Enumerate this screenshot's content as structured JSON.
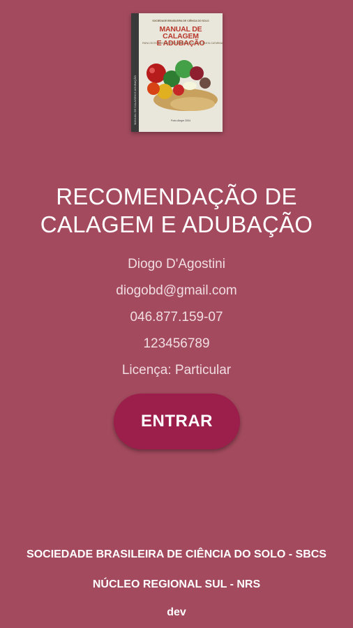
{
  "book_cover": {
    "publisher": "SOCIEDADE BRASILEIRA DE CIÊNCIA DO SOLO",
    "title_line1": "MANUAL DE CALAGEM",
    "title_line2": "E ADUBAÇÃO",
    "subtitle": "PARA OS ESTADOS DO RIO GRANDE DO SUL E DE SANTA CATARINA",
    "spine": "MANUAL DE CALAGEM E ADUBAÇÃO",
    "footer": "Porto Alegre 2004"
  },
  "headline": {
    "line1": "RECOMENDAÇÃO DE",
    "line2": "CALAGEM E ADUBAÇÃO"
  },
  "user": {
    "name": "Diogo D'Agostini",
    "email": "diogobd@gmail.com",
    "cpf": "046.877.159-07",
    "code": "123456789",
    "license": "Licença: Particular"
  },
  "actions": {
    "enter_label": "ENTRAR"
  },
  "footer": {
    "society": "SOCIEDADE BRASILEIRA DE CIÊNCIA DO SOLO - SBCS",
    "nucleus": "NÚCLEO REGIONAL SUL - NRS",
    "build": "dev"
  },
  "colors": {
    "background": "#a34a5e",
    "button": "#9b1e4b",
    "text": "#ffffff"
  }
}
